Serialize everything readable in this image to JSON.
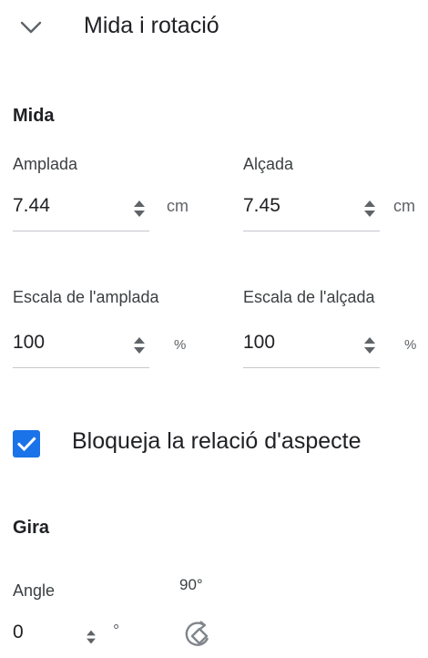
{
  "section": {
    "title": "Mida i rotació"
  },
  "size": {
    "heading": "Mida",
    "width_label": "Amplada",
    "width_value": "7.44",
    "width_unit": "cm",
    "height_label": "Alçada",
    "height_value": "7.45",
    "height_unit": "cm",
    "scale_width_label": "Escala de l'amplada",
    "scale_width_value": "100",
    "scale_width_unit": "%",
    "scale_height_label": "Escala de l'alçada",
    "scale_height_value": "100",
    "scale_height_unit": "%"
  },
  "lock_aspect": {
    "label": "Bloqueja la relació d'aspecte",
    "checked": true
  },
  "rotate": {
    "heading": "Gira",
    "angle_label": "Angle",
    "angle_value": "0",
    "angle_unit": "°",
    "rotate_90_label": "90°"
  },
  "colors": {
    "accent": "#1a73e8",
    "underline": "#c4c7cc",
    "text": "#202124"
  },
  "icons": {
    "collapse": "chevron-down-icon",
    "spinner": "up-down-spinner-icon",
    "checkbox": "checkmark-icon",
    "rotate": "rotate-90-icon"
  }
}
